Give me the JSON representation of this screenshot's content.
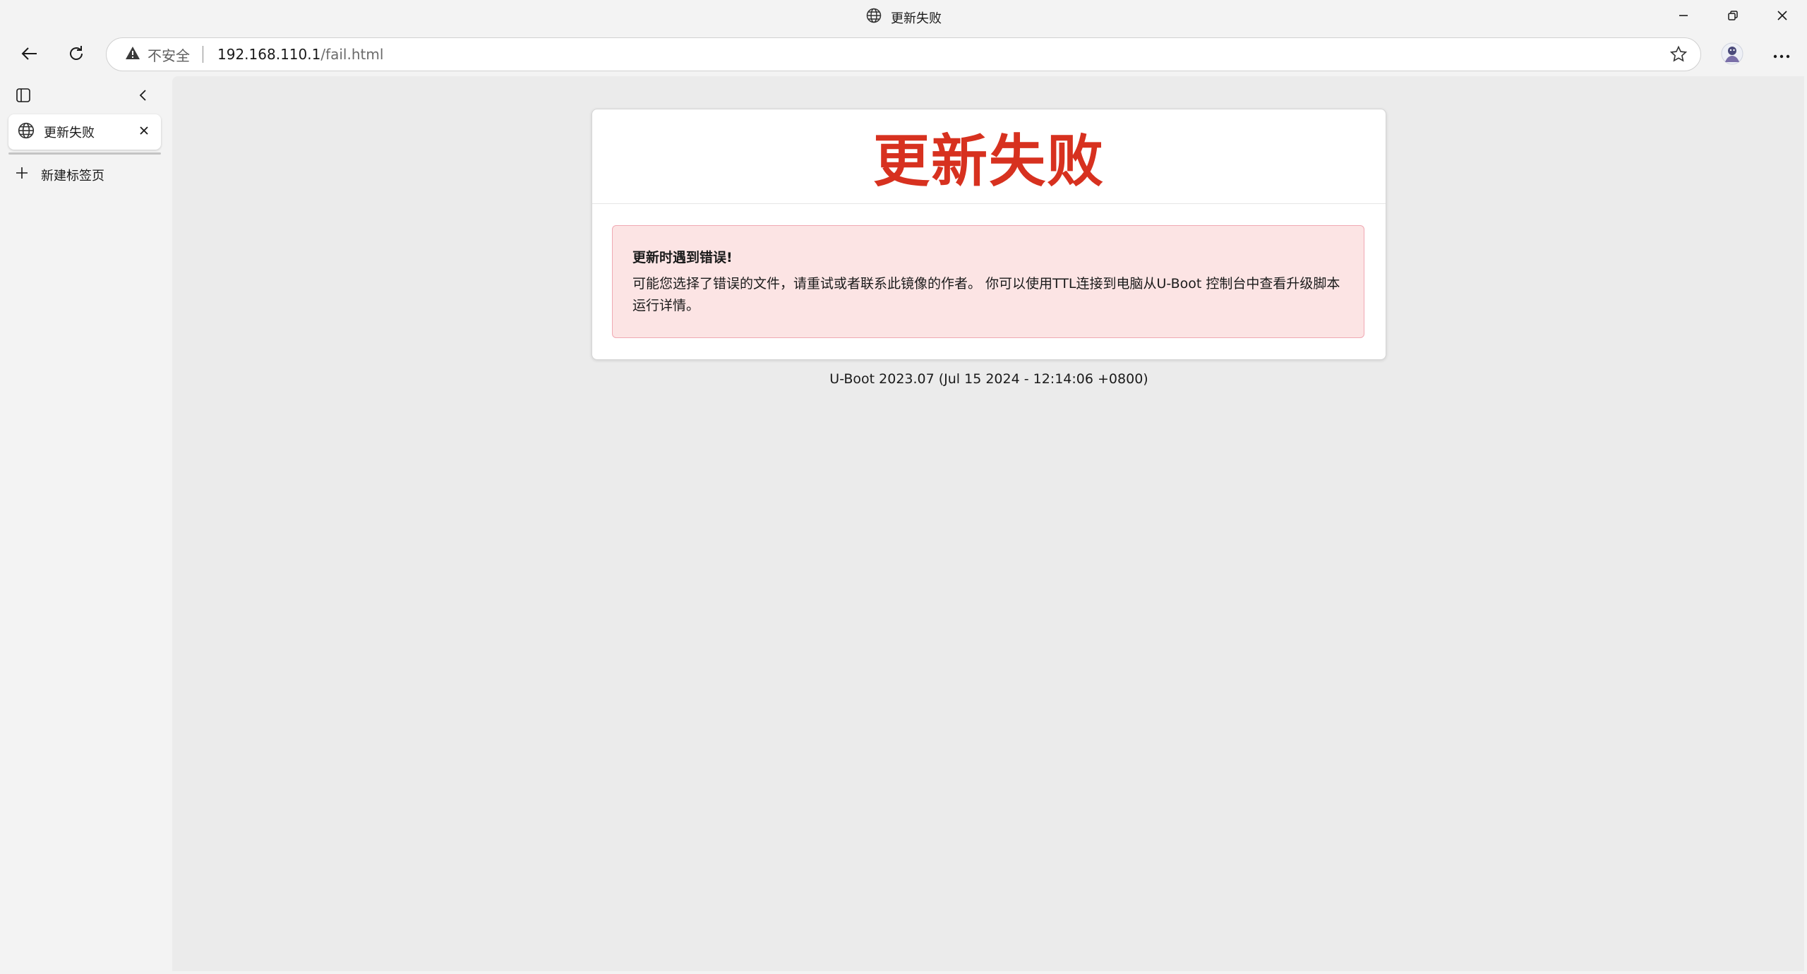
{
  "window": {
    "title": "更新失败",
    "controls": [
      "minimize-icon",
      "restore-icon",
      "close-icon"
    ]
  },
  "toolbar": {
    "security_label": "不安全",
    "url_host": "192.168.110.1",
    "url_path": "/fail.html"
  },
  "sidebar": {
    "active_tab": {
      "label": "更新失败",
      "icon": "globe-icon"
    },
    "new_tab_label": "新建标签页"
  },
  "page": {
    "title": "更新失败",
    "alert": {
      "heading": "更新时遇到错误!",
      "body": "可能您选择了错误的文件，请重试或者联系此镜像的作者。 你可以使用TTL连接到电脑从U-Boot 控制台中查看升级脚本运行详情。"
    },
    "footer": "U-Boot 2023.07 (Jul 15 2024 - 12:14:06 +0800)"
  },
  "colors": {
    "title_red": "#d7311f",
    "alert_bg": "#fce4e4",
    "alert_border": "#f0a9b3",
    "content_bg": "#ebebeb"
  }
}
